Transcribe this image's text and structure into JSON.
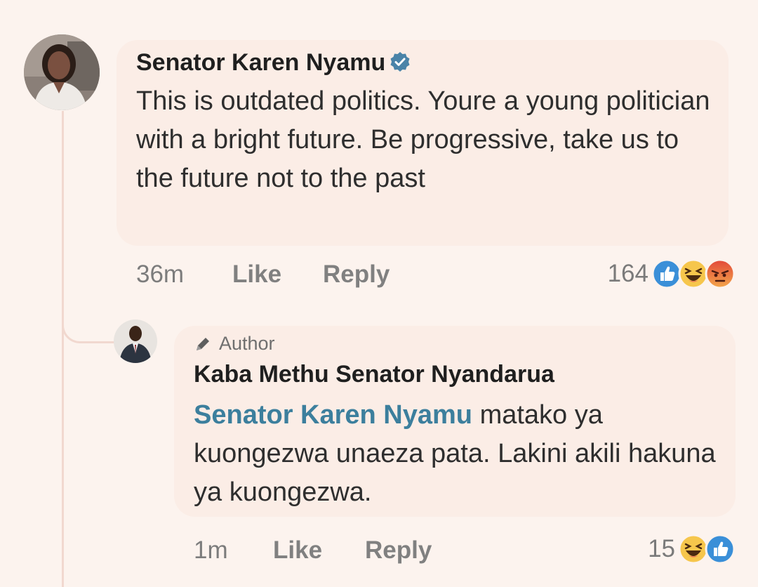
{
  "comment": {
    "author": "Senator Karen Nyamu",
    "verified": true,
    "avatar": "woman-portrait-avatar",
    "text": "This is outdated politics. Youre a young politician with a bright future. Be progressive, take us to the future not to the past",
    "time": "36m",
    "like_label": "Like",
    "reply_label": "Reply",
    "reaction_count": "164",
    "reactions": [
      "like-reaction-icon",
      "haha-reaction-icon",
      "angry-reaction-icon"
    ]
  },
  "reply": {
    "badge": "Author",
    "author": "Kaba Methu Senator Nyandarua",
    "avatar": "man-in-suit-avatar",
    "mention": "Senator Karen Nyamu",
    "text": " matako ya kuongezwa unaeza pata. Lakini akili hakuna ya kuongezwa.",
    "time": "1m",
    "like_label": "Like",
    "reply_label": "Reply",
    "reaction_count": "15",
    "reactions": [
      "haha-reaction-icon",
      "like-reaction-icon"
    ]
  },
  "colors": {
    "background": "#fcf3ee",
    "bubble": "#fbede6",
    "mention": "#3c7f9d",
    "verified": "#4a83a8",
    "like_blue": "#3a8fd8",
    "haha_yellow": "#f6c64c",
    "angry_red": "#e2483a"
  }
}
